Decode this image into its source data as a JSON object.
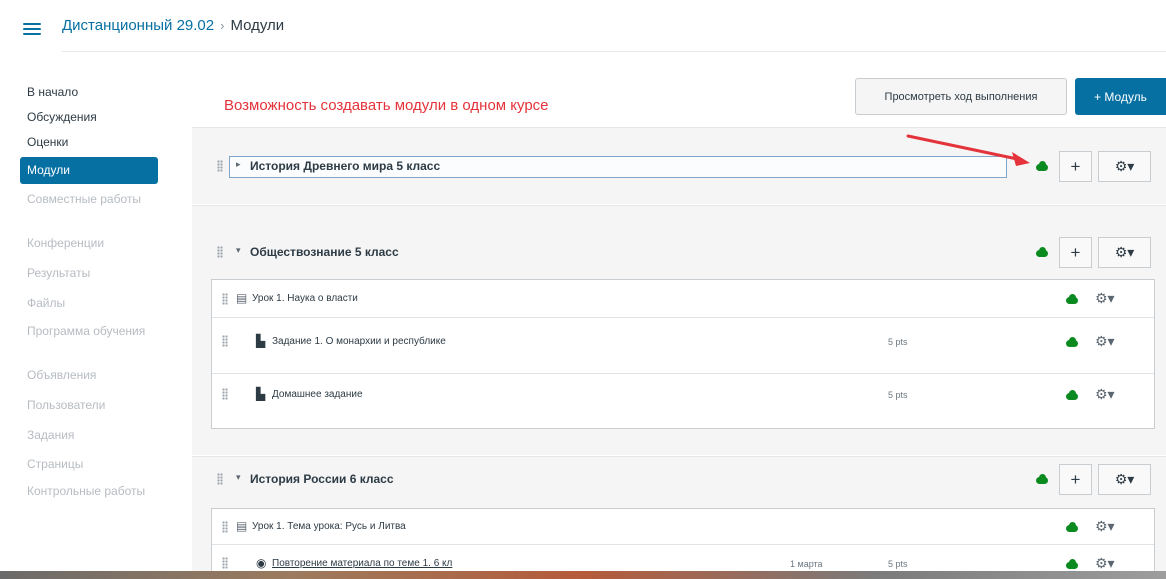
{
  "header": {
    "course": "Дистанционный 29.02",
    "separator": "›",
    "current": "Модули",
    "icon": "hamburger-icon"
  },
  "nav": {
    "home": "В начало",
    "discussions": "Обсуждения",
    "grades": "Оценки",
    "modules": "Модули",
    "collaborations": "Совместные работы",
    "conferences": "Конференции",
    "outcomes": "Результаты",
    "files": "Файлы",
    "syllabus": "Программа обучения",
    "announcements": "Объявления",
    "people": "Пользователи",
    "assignments": "Задания",
    "pages": "Страницы",
    "quizzes": "Контрольные работы"
  },
  "annotation": "Возможность создавать модули в одном курсе",
  "toolbar": {
    "view_progress": "Просмотреть ход выполнения",
    "add_module": "+ Модуль"
  },
  "modules": {
    "m1": {
      "title": "История Древнего мира 5 класс",
      "arrow": "▸"
    },
    "m2": {
      "title": "Обществознание 5 класс",
      "arrow": "▾",
      "i1": {
        "title": "Урок 1. Наука о власти"
      },
      "i2": {
        "title": "Задание 1. О монархии и республике",
        "points": "5 pts"
      },
      "i3": {
        "title": "Домашнее задание",
        "points": "5 pts"
      }
    },
    "m3": {
      "title": "История России 6 класс",
      "arrow": "▾",
      "i1": {
        "title": "Урок 1. Тема урока: Русь и Литва"
      },
      "i2": {
        "title": "Повторение материала по теме 1. 6 кл",
        "due": "1 марта",
        "points": "5 pts"
      }
    }
  },
  "glyphs": {
    "plus": "+",
    "gear": "⚙▾",
    "page": "▤",
    "assignment": "▙",
    "quiz": "◉"
  },
  "colors": {
    "accent": "#0770a3",
    "published": "#0b8a1f",
    "annotation": "#e4333a"
  }
}
